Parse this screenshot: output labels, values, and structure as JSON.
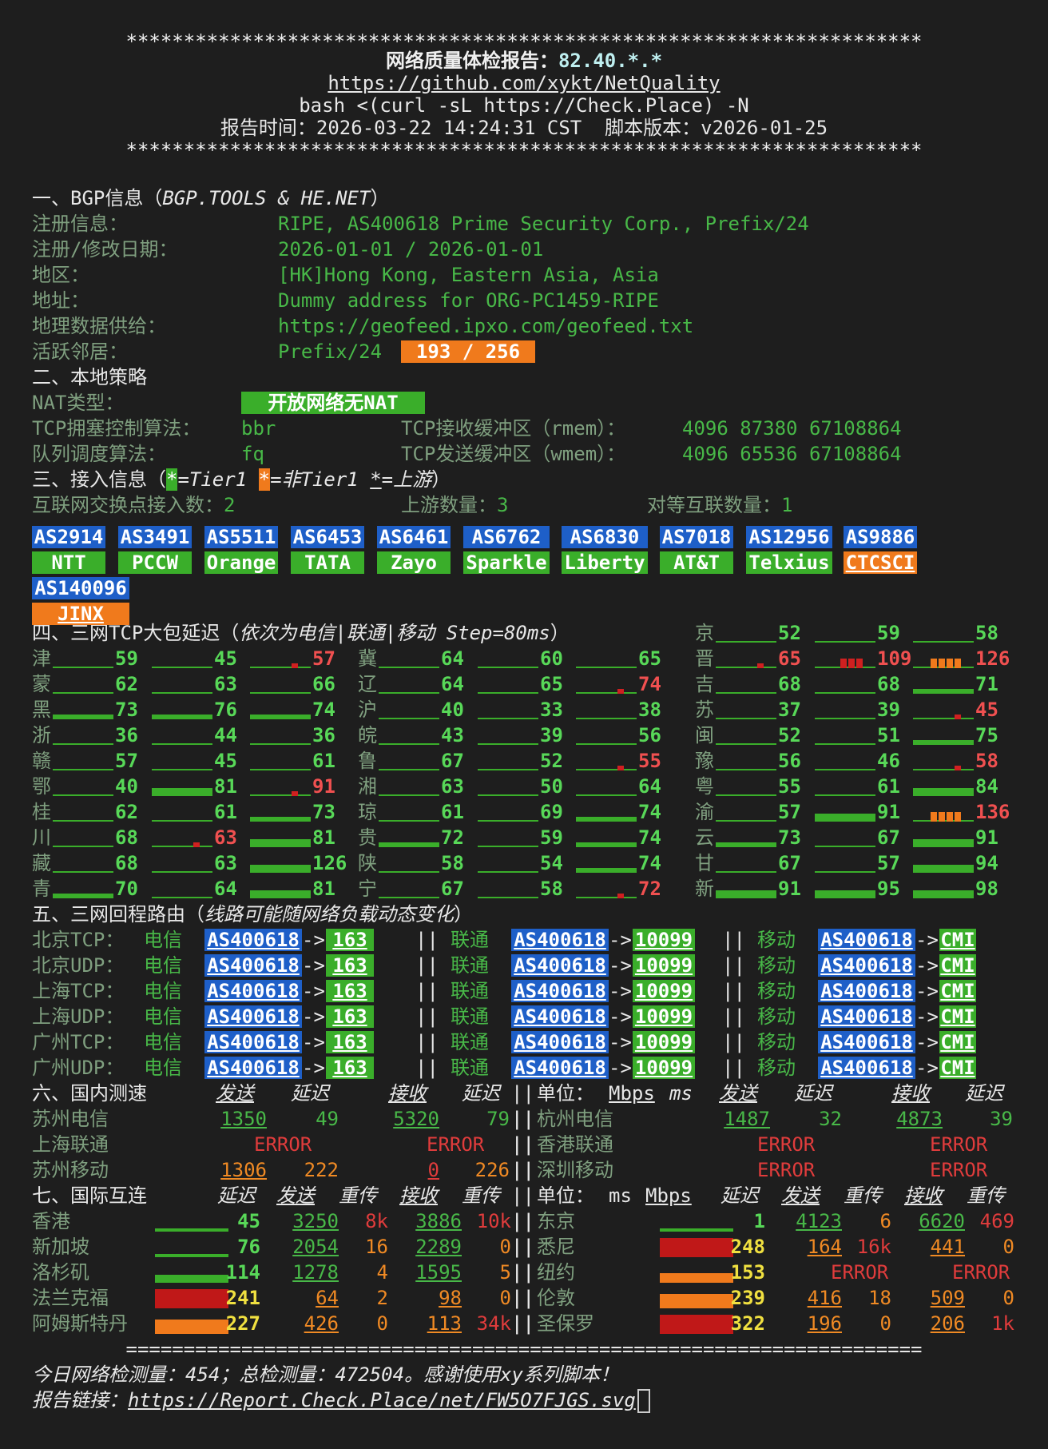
{
  "header": {
    "stars": "*********************************************************************",
    "title": "网络质量体检报告：",
    "ip": "82.40.*.*",
    "repo": "https://github.com/xykt/NetQuality",
    "cmd": "bash <(curl -sL https://Check.Place) -N",
    "time_label": "报告时间：2026-03-22 14:24:31 CST  脚本版本：v2026-01-25"
  },
  "bgp": {
    "section": "一、BGP信息（",
    "section_i": "BGP.TOOLS & HE.NET",
    "section_end": "）",
    "rows": [
      {
        "k": "注册信息：",
        "v": "RIPE, AS400618 Prime Security Corp., Prefix/24"
      },
      {
        "k": "注册/修改日期：",
        "v": "2026-01-01 / 2026-01-01"
      },
      {
        "k": "地区：",
        "v": "[HK]Hong Kong, Eastern Asia, Asia"
      },
      {
        "k": "地址：",
        "v": "Dummy address for ORG-PC1459-RIPE"
      },
      {
        "k": "地理数据供给：",
        "v": "https://geofeed.ipxo.com/geofeed.txt"
      },
      {
        "k": "活跃邻居：",
        "v": "Prefix/24"
      }
    ],
    "neighbors_badge": "193 / 256"
  },
  "local": {
    "section": "二、本地策略",
    "nat_label": "NAT类型：",
    "nat_value": "开放网络无NAT",
    "cc_label": "TCP拥塞控制算法：",
    "cc_value": "bbr",
    "rmem_label": "TCP接收缓冲区（rmem）：",
    "rmem_value": "4096 87380 67108864",
    "qd_label": "队列调度算法：",
    "qd_value": "fq",
    "wmem_label": "TCP发送缓冲区（wmem）：",
    "wmem_value": "4096 65536 67108864"
  },
  "access": {
    "section": "三、接入信息（",
    "t1": "*",
    "t1_label": "=Tier1 ",
    "nt1": "*",
    "nt1_label": "=非Tier1 ",
    "up": "*",
    "up_label": "=上游",
    "end": "）",
    "ixp_label": "互联网交换点接入数：",
    "ixp_value": "2",
    "upstream_label": "上游数量：",
    "upstream_value": "3",
    "peer_label": "对等互联数量：",
    "peer_value": "1",
    "asns": [
      {
        "as": "AS2914",
        "name": "NTT",
        "color": "green"
      },
      {
        "as": "AS3491",
        "name": "PCCW",
        "color": "green"
      },
      {
        "as": "AS5511",
        "name": "Orange",
        "color": "green"
      },
      {
        "as": "AS6453",
        "name": "TATA",
        "color": "green"
      },
      {
        "as": "AS6461",
        "name": "Zayo",
        "color": "green"
      },
      {
        "as": "AS6762",
        "name": "Sparkle",
        "color": "green"
      },
      {
        "as": "AS6830",
        "name": "Liberty",
        "color": "green"
      },
      {
        "as": "AS7018",
        "name": "AT&T",
        "color": "green"
      },
      {
        "as": "AS12956",
        "name": "Telxius",
        "color": "green"
      },
      {
        "as": "AS9886",
        "name": "CTCSCI",
        "color": "orange"
      },
      {
        "as": "AS140096",
        "name": "JINX",
        "color": "orange"
      }
    ]
  },
  "latency": {
    "section": "四、三网TCP大包延迟（",
    "section_i": "依次为电信|联通|移动 Step=80ms",
    "section_end": "）",
    "provinces": [
      {
        "n": "京",
        "v": [
          52,
          59,
          58
        ],
        "p": [
          0,
          0,
          0
        ]
      },
      {
        "n": "津",
        "v": [
          59,
          45,
          57
        ],
        "p": [
          0,
          0,
          1
        ]
      },
      {
        "n": "冀",
        "v": [
          64,
          60,
          65
        ],
        "p": [
          0,
          0,
          0
        ]
      },
      {
        "n": "晋",
        "v": [
          65,
          109,
          126
        ],
        "p": [
          1,
          2,
          3
        ]
      },
      {
        "n": "蒙",
        "v": [
          62,
          63,
          66
        ],
        "p": [
          0,
          0,
          0
        ]
      },
      {
        "n": "辽",
        "v": [
          64,
          65,
          74
        ],
        "p": [
          0,
          0,
          1
        ]
      },
      {
        "n": "吉",
        "v": [
          68,
          68,
          71
        ],
        "p": [
          0,
          0,
          0
        ]
      },
      {
        "n": "黑",
        "v": [
          73,
          76,
          74
        ],
        "p": [
          0,
          0,
          0
        ]
      },
      {
        "n": "沪",
        "v": [
          40,
          33,
          38
        ],
        "p": [
          0,
          0,
          0
        ]
      },
      {
        "n": "苏",
        "v": [
          37,
          39,
          45
        ],
        "p": [
          0,
          0,
          1
        ]
      },
      {
        "n": "浙",
        "v": [
          36,
          44,
          36
        ],
        "p": [
          0,
          0,
          0
        ]
      },
      {
        "n": "皖",
        "v": [
          43,
          39,
          56
        ],
        "p": [
          0,
          0,
          0
        ]
      },
      {
        "n": "闽",
        "v": [
          52,
          51,
          75
        ],
        "p": [
          0,
          0,
          0
        ]
      },
      {
        "n": "赣",
        "v": [
          57,
          45,
          61
        ],
        "p": [
          0,
          0,
          0
        ]
      },
      {
        "n": "鲁",
        "v": [
          67,
          52,
          55
        ],
        "p": [
          0,
          0,
          1
        ]
      },
      {
        "n": "豫",
        "v": [
          56,
          46,
          58
        ],
        "p": [
          0,
          0,
          1
        ]
      },
      {
        "n": "鄂",
        "v": [
          40,
          81,
          91
        ],
        "p": [
          0,
          0,
          1
        ]
      },
      {
        "n": "湘",
        "v": [
          63,
          50,
          64
        ],
        "p": [
          0,
          0,
          0
        ]
      },
      {
        "n": "粤",
        "v": [
          55,
          61,
          84
        ],
        "p": [
          0,
          0,
          0
        ]
      },
      {
        "n": "桂",
        "v": [
          62,
          61,
          73
        ],
        "p": [
          0,
          0,
          0
        ]
      },
      {
        "n": "琼",
        "v": [
          61,
          69,
          74
        ],
        "p": [
          0,
          0,
          0
        ]
      },
      {
        "n": "渝",
        "v": [
          57,
          91,
          136
        ],
        "p": [
          0,
          0,
          3
        ]
      },
      {
        "n": "川",
        "v": [
          68,
          63,
          81
        ],
        "p": [
          0,
          1,
          0
        ]
      },
      {
        "n": "贵",
        "v": [
          72,
          59,
          74
        ],
        "p": [
          0,
          0,
          0
        ]
      },
      {
        "n": "云",
        "v": [
          73,
          67,
          91
        ],
        "p": [
          0,
          0,
          0
        ]
      },
      {
        "n": "藏",
        "v": [
          68,
          63,
          126
        ],
        "p": [
          0,
          0,
          0
        ]
      },
      {
        "n": "陕",
        "v": [
          58,
          54,
          74
        ],
        "p": [
          0,
          0,
          0
        ]
      },
      {
        "n": "甘",
        "v": [
          67,
          57,
          94
        ],
        "p": [
          0,
          0,
          0
        ]
      },
      {
        "n": "青",
        "v": [
          70,
          64,
          81
        ],
        "p": [
          0,
          0,
          0
        ]
      },
      {
        "n": "宁",
        "v": [
          67,
          58,
          72
        ],
        "p": [
          0,
          0,
          1
        ]
      },
      {
        "n": "新",
        "v": [
          91,
          95,
          98
        ],
        "p": [
          0,
          0,
          0
        ]
      }
    ]
  },
  "route": {
    "section": "五、三网回程路由（",
    "section_i": "线路可能随网络负载动态变化",
    "section_end": "）",
    "rows": [
      {
        "k": "北京TCP："
      },
      {
        "k": "北京UDP："
      },
      {
        "k": "上海TCP："
      },
      {
        "k": "上海UDP："
      },
      {
        "k": "广州TCP："
      },
      {
        "k": "广州UDP："
      }
    ],
    "ct": "电信",
    "cu": "联通",
    "cm": "移动",
    "sep": "||",
    "as": "AS400618",
    "arrow": "->",
    "ct_asn": "163",
    "cu_asn": "10099",
    "cm_asn": "CMI"
  },
  "speed": {
    "section": "六、国内测速",
    "h_send": "发送",
    "h_lat": "延迟",
    "h_recv": "接收",
    "h_lat2": "延迟",
    "unit_label": "单位：",
    "unit_mbps": "Mbps",
    "unit_ms": "ms",
    "left": [
      {
        "n": "苏州电信",
        "send": "1350",
        "lat": "49",
        "recv": "5320",
        "lat2": "79"
      },
      {
        "n": "上海联通",
        "err1": "ERROR",
        "err2": "ERROR"
      },
      {
        "n": "苏州移动",
        "send": "1306",
        "lat": "222",
        "recv": "0",
        "lat2": "226"
      }
    ],
    "right": [
      {
        "n": "杭州电信",
        "send": "1487",
        "lat": "32",
        "recv": "4873",
        "lat2": "39"
      },
      {
        "n": "香港联通",
        "err1": "ERROR",
        "err2": "ERROR"
      },
      {
        "n": "深圳移动",
        "err1": "ERROR",
        "err2": "ERROR"
      }
    ]
  },
  "intl": {
    "section": "七、国际互连",
    "h_lat": "延迟",
    "h_send": "发送",
    "h_retx": "重传",
    "h_recv": "接收",
    "h_retx2": "重传",
    "unit_label": "单位：",
    "unit_ms": "ms",
    "unit_mbps": "Mbps",
    "left": [
      {
        "n": "香港",
        "lat": "45",
        "send": "3250",
        "r1": "8k",
        "recv": "3886",
        "r2": "10k",
        "bar": "green-line"
      },
      {
        "n": "新加坡",
        "lat": "76",
        "send": "2054",
        "r1": "16",
        "recv": "2289",
        "r2": "0",
        "bar": "green-line"
      },
      {
        "n": "洛杉矶",
        "lat": "114",
        "send": "1278",
        "r1": "4",
        "recv": "1595",
        "r2": "5",
        "bar": "green-block"
      },
      {
        "n": "法兰克福",
        "lat": "241",
        "send": "64",
        "r1": "2",
        "recv": "98",
        "r2": "0",
        "bar": "red"
      },
      {
        "n": "阿姆斯特丹",
        "lat": "227",
        "send": "426",
        "r1": "0",
        "recv": "113",
        "r2": "34k",
        "bar": "orange"
      }
    ],
    "right": [
      {
        "n": "东京",
        "lat": "1",
        "send": "4123",
        "r1": "6",
        "recv": "6620",
        "r2": "469",
        "bar": "green-line"
      },
      {
        "n": "悉尼",
        "lat": "248",
        "send": "164",
        "r1": "16k",
        "recv": "441",
        "r2": "0",
        "bar": "red"
      },
      {
        "n": "纽约",
        "lat": "153",
        "err": "ERROR",
        "err2": "ERROR",
        "bar": "orange-line"
      },
      {
        "n": "伦敦",
        "lat": "239",
        "send": "416",
        "r1": "18",
        "recv": "509",
        "r2": "0",
        "bar": "orange"
      },
      {
        "n": "圣保罗",
        "lat": "322",
        "send": "196",
        "r1": "0",
        "recv": "206",
        "r2": "1k",
        "bar": "red"
      }
    ]
  },
  "footer": {
    "line": "=====================================================================",
    "stats": "今日网络检测量：454；总检测量：472504。感谢使用xy系列脚本！",
    "link_label": "报告链接：",
    "link": "https://Report.Check.Place/net/FW5O7FJGS.svg"
  },
  "colors": {
    "bg": "#1e1e1e",
    "green": "#48b848",
    "red": "#e03c3c",
    "orange": "#f08a24",
    "blue": "#1e5fc8",
    "badge_green": "#3aae2a"
  }
}
